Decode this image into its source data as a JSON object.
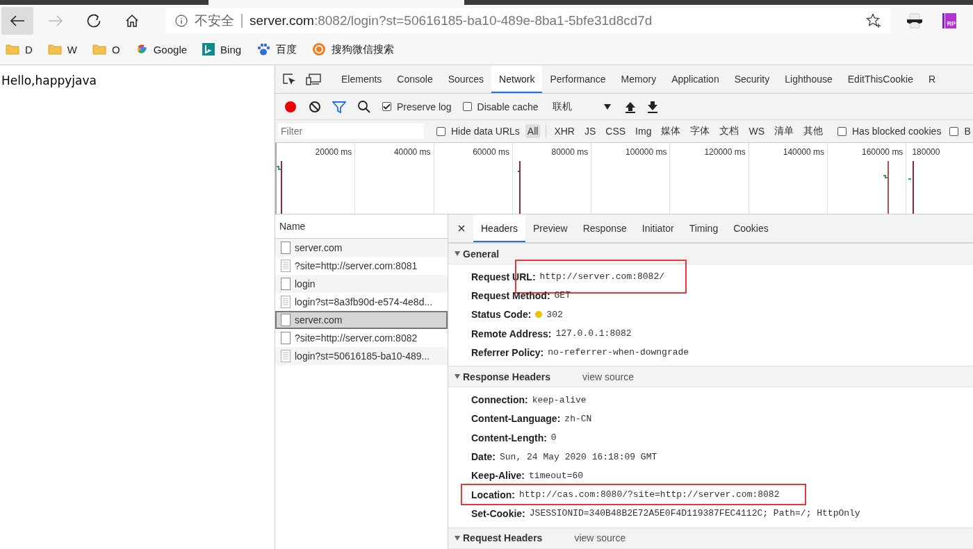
{
  "browser": {
    "back_enabled": true,
    "forward_enabled": false,
    "address": {
      "security_label": "不安全",
      "host": "server.com",
      "path": ":8082/login?st=50616185-ba10-489e-8ba1-5bfe31d8cd7d"
    },
    "extensions": [
      {
        "kind": "mask"
      },
      {
        "kind": "badge",
        "label": "RP"
      }
    ],
    "bookmarks": [
      {
        "label": "D",
        "kind": "folder"
      },
      {
        "label": "W",
        "kind": "folder"
      },
      {
        "label": "O",
        "kind": "folder"
      },
      {
        "label": "Google",
        "kind": "google"
      },
      {
        "label": "Bing",
        "kind": "bing"
      },
      {
        "label": "百度",
        "kind": "baidu"
      },
      {
        "label": "搜狗微信搜索",
        "kind": "sogou"
      }
    ]
  },
  "page": {
    "text": "Hello,happyjava"
  },
  "devtools": {
    "tabs": [
      {
        "label": "Elements",
        "selected": false
      },
      {
        "label": "Console",
        "selected": false
      },
      {
        "label": "Sources",
        "selected": false
      },
      {
        "label": "Network",
        "selected": true
      },
      {
        "label": "Performance",
        "selected": false
      },
      {
        "label": "Memory",
        "selected": false
      },
      {
        "label": "Application",
        "selected": false
      },
      {
        "label": "Security",
        "selected": false
      },
      {
        "label": "Lighthouse",
        "selected": false
      },
      {
        "label": "EditThisCookie",
        "selected": false
      },
      {
        "label": "R",
        "selected": false
      }
    ],
    "toolbar": {
      "recording": true,
      "filter_active": true,
      "preserve_log": {
        "label": "Preserve log",
        "checked": true
      },
      "disable_cache": {
        "label": "Disable cache",
        "checked": false
      },
      "throttling": "联机"
    },
    "filter": {
      "placeholder": "Filter",
      "hide_data_urls": {
        "label": "Hide data URLs",
        "checked": false
      },
      "types": [
        {
          "label": "All",
          "selected": true
        },
        {
          "label": "XHR",
          "selected": false
        },
        {
          "label": "JS",
          "selected": false
        },
        {
          "label": "CSS",
          "selected": false
        },
        {
          "label": "Img",
          "selected": false
        },
        {
          "label": "媒体",
          "selected": false
        },
        {
          "label": "字体",
          "selected": false
        },
        {
          "label": "文档",
          "selected": false
        },
        {
          "label": "WS",
          "selected": false
        },
        {
          "label": "清单",
          "selected": false
        },
        {
          "label": "其他",
          "selected": false
        }
      ],
      "blocked_cookies": {
        "label": "Has blocked cookies",
        "checked": false
      },
      "cut_checkbox": {
        "label": "B",
        "checked": false
      }
    },
    "timeline_ticks": [
      "20000 ms",
      "40000 ms",
      "60000 ms",
      "80000 ms",
      "100000 ms",
      "120000 ms",
      "140000 ms",
      "160000 ms",
      "180000"
    ],
    "requests": {
      "column": "Name",
      "rows": [
        {
          "name": "server.com",
          "kind": "document",
          "selected": false
        },
        {
          "name": "?site=http://server.com:8081",
          "kind": "text",
          "selected": false
        },
        {
          "name": "login",
          "kind": "document",
          "selected": false
        },
        {
          "name": "login?st=8a3fb90d-e574-4e8d...",
          "kind": "text",
          "selected": false
        },
        {
          "name": "server.com",
          "kind": "document",
          "selected": true
        },
        {
          "name": "?site=http://server.com:8082",
          "kind": "document",
          "selected": false
        },
        {
          "name": "login?st=50616185-ba10-489...",
          "kind": "text",
          "selected": false
        }
      ]
    },
    "detail_tabs": [
      {
        "label": "Headers",
        "selected": true
      },
      {
        "label": "Preview",
        "selected": false
      },
      {
        "label": "Response",
        "selected": false
      },
      {
        "label": "Initiator",
        "selected": false
      },
      {
        "label": "Timing",
        "selected": false
      },
      {
        "label": "Cookies",
        "selected": false
      }
    ],
    "sections": [
      {
        "title": "General",
        "expanded": true,
        "items": [
          {
            "name": "Request URL:",
            "value": "http://server.com:8082/",
            "highlight_value": true
          },
          {
            "name": "Request Method:",
            "value": "GET"
          },
          {
            "name": "Status Code:",
            "value": "302",
            "color": "#f2c200"
          },
          {
            "name": "Remote Address:",
            "value": "127.0.0.1:8082"
          },
          {
            "name": "Referrer Policy:",
            "value": "no-referrer-when-downgrade"
          }
        ]
      },
      {
        "title": "Response Headers",
        "view_source": "view source",
        "expanded": true,
        "items": [
          {
            "name": "Connection:",
            "value": "keep-alive"
          },
          {
            "name": "Content-Language:",
            "value": "zh-CN"
          },
          {
            "name": "Content-Length:",
            "value": "0"
          },
          {
            "name": "Date:",
            "value": "Sun, 24 May 2020 16:18:09 GMT"
          },
          {
            "name": "Keep-Alive:",
            "value": "timeout=60"
          },
          {
            "name": "Location:",
            "value": "http://cas.com:8080/?site=http://server.com:8082",
            "highlight_row": true
          },
          {
            "name": "Set-Cookie:",
            "value": "JSESSIONID=340B48B2E72A5E0F4D119387FEC4112C; Path=/; HttpOnly"
          }
        ]
      },
      {
        "title": "Request Headers",
        "view_source": "view source",
        "expanded": true
      }
    ]
  }
}
